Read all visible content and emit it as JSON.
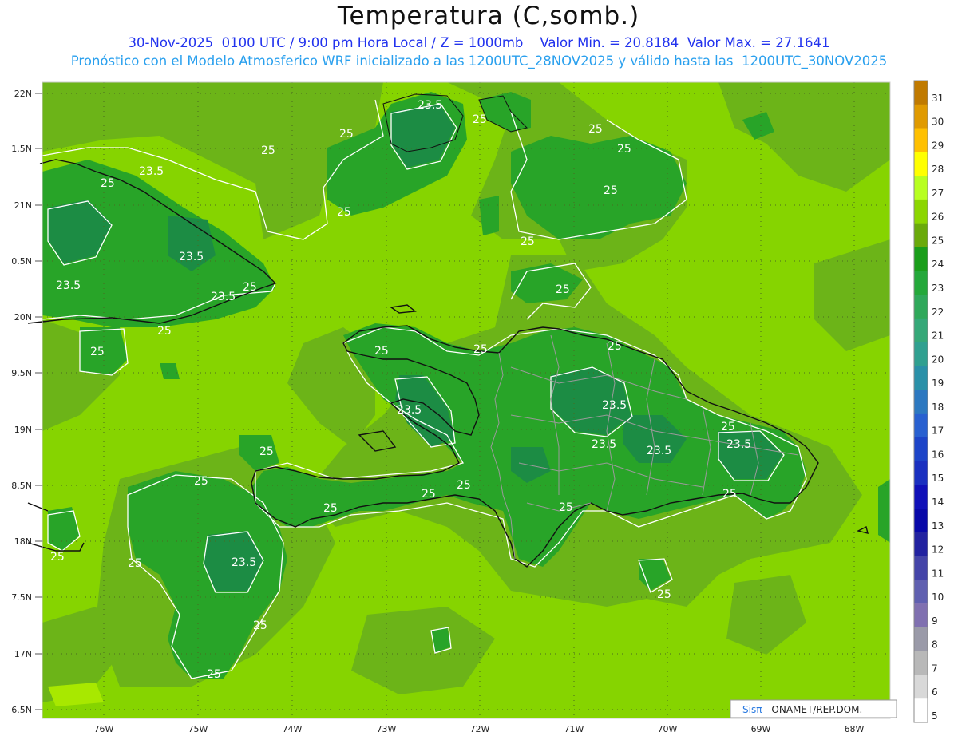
{
  "header": {
    "title": "Temperatura (C,somb.)",
    "line1": "30-Nov-2025  0100 UTC / 9:00 pm Hora Local / Z = 1000mb    Valor Min. = 20.8184  Valor Max. = 27.1641",
    "line2": "Pronóstico con el Modelo Atmosferico WRF inicializado a las 1200UTC_28NOV2025 y válido hasta las  1200UTC_30NOV2025"
  },
  "axes": {
    "y_ticks": [
      "22N",
      "1.5N",
      "21N",
      "0.5N",
      "20N",
      "9.5N",
      "19N",
      "8.5N",
      "18N",
      "7.5N",
      "17N",
      "6.5N"
    ],
    "x_ticks": [
      "76W",
      "75W",
      "74W",
      "73W",
      "72W",
      "71W",
      "70W",
      "69W",
      "68W"
    ]
  },
  "colorbar": {
    "labels": [
      "31",
      "30",
      "29",
      "28",
      "27",
      "26",
      "25",
      "24",
      "23",
      "22",
      "21",
      "20",
      "19",
      "18",
      "17",
      "16",
      "15",
      "14",
      "13",
      "12",
      "11",
      "10",
      "9",
      "8",
      "7",
      "6",
      "5"
    ],
    "colors": [
      "#c07a00",
      "#e09a00",
      "#ffc000",
      "#ffff00",
      "#b8ff20",
      "#8cd600",
      "#6aaa0a",
      "#1a9e1a",
      "#24a83a",
      "#2fa85a",
      "#35a878",
      "#30a090",
      "#2a90a8",
      "#2c78c0",
      "#2860d0",
      "#1d44c8",
      "#1a30c0",
      "#1010b8",
      "#0808a8",
      "#2222a0",
      "#4444a8",
      "#6060b0",
      "#8070b0",
      "#9a9aa8",
      "#b8b8b8",
      "#d8d8d8",
      "#ffffff"
    ]
  },
  "map": {
    "contour_labels": [
      "23.5",
      "25",
      "25",
      "25",
      "25",
      "25",
      "25",
      "25",
      "23.5",
      "25",
      "23.5",
      "23.5",
      "23.5",
      "25",
      "23.5",
      "25",
      "25",
      "25",
      "25",
      "25",
      "23.5",
      "25",
      "25",
      "23.5",
      "23.5",
      "25",
      "23.5",
      "25",
      "25",
      "25",
      "25",
      "25",
      "25",
      "25",
      "23.5",
      "25",
      "25",
      "25",
      "25",
      "25"
    ],
    "colors": {
      "base": "#86d400",
      "mid": "#6cb418",
      "dark": "#28a428",
      "darkest": "#1c8c44",
      "coast": "#111111",
      "border": "#9a9a9a"
    }
  },
  "credit": {
    "brand": "Sisπ",
    "text": " - ONAMET/REP.DOM."
  }
}
